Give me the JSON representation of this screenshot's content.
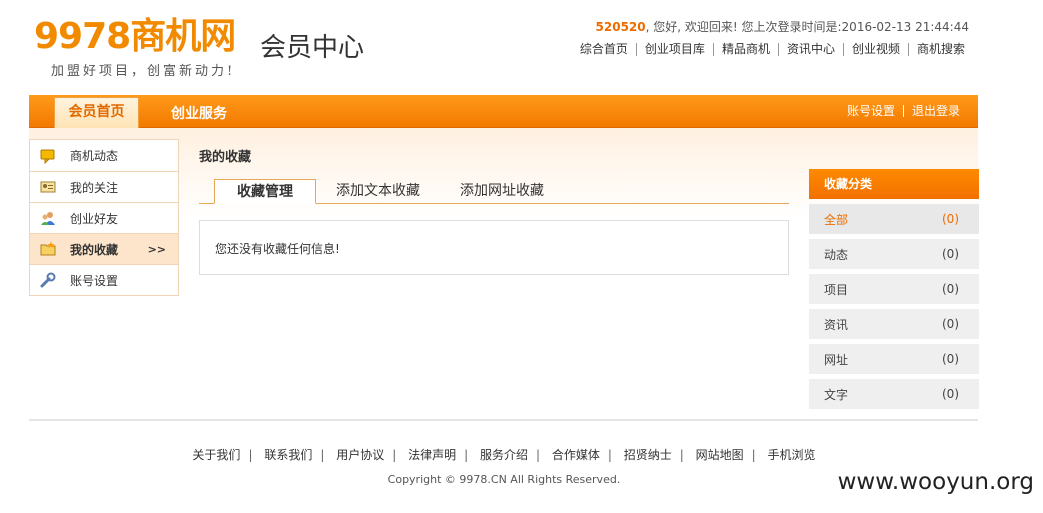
{
  "header": {
    "logo_text": "9978商机网",
    "slogan": "加盟好项目，创富新动力!",
    "title": "会员中心",
    "welcome_user": "520520",
    "welcome_text": ", 您好, 欢迎回来!  您上次登录时间是:2016-02-13 21:44:44",
    "topnav": [
      "综合首页",
      "创业项目库",
      "精品商机",
      "资讯中心",
      "创业视频",
      "商机搜索"
    ]
  },
  "mainbar": {
    "home_tab": "会员首页",
    "service_tab": "创业服务",
    "account_settings": "账号设置",
    "logout": "退出登录"
  },
  "sidebar": {
    "items": [
      {
        "label": "商机动态",
        "icon": "speech-bubble-icon"
      },
      {
        "label": "我的关注",
        "icon": "id-card-icon"
      },
      {
        "label": "创业好友",
        "icon": "friends-icon"
      },
      {
        "label": "我的收藏",
        "icon": "folder-star-icon",
        "active": true,
        "arrow": ">>"
      },
      {
        "label": "账号设置",
        "icon": "wrench-icon"
      }
    ]
  },
  "main": {
    "title": "我的收藏",
    "tabs": [
      "收藏管理",
      "添加文本收藏",
      "添加网址收藏"
    ],
    "empty_message": "您还没有收藏任何信息!"
  },
  "categories": {
    "title": "收藏分类",
    "items": [
      {
        "label": "全部",
        "count": "(0)"
      },
      {
        "label": "动态",
        "count": "(0)"
      },
      {
        "label": "项目",
        "count": "(0)"
      },
      {
        "label": "资讯",
        "count": "(0)"
      },
      {
        "label": "网址",
        "count": "(0)"
      },
      {
        "label": "文字",
        "count": "(0)"
      }
    ]
  },
  "footer": {
    "links": [
      "关于我们",
      "联系我们",
      "用户协议",
      "法律声明",
      "服务介绍",
      "合作媒体",
      "招贤纳士",
      "网站地图",
      "手机浏览"
    ],
    "separator": "|",
    "copyright": "Copyright © 9978.CN All Rights Reserved."
  },
  "watermark": "www.wooyun.org",
  "colors": {
    "accent": "#f27a00",
    "active_text": "#ec6c00",
    "sidebar_active_bg": "#fde5cb"
  }
}
